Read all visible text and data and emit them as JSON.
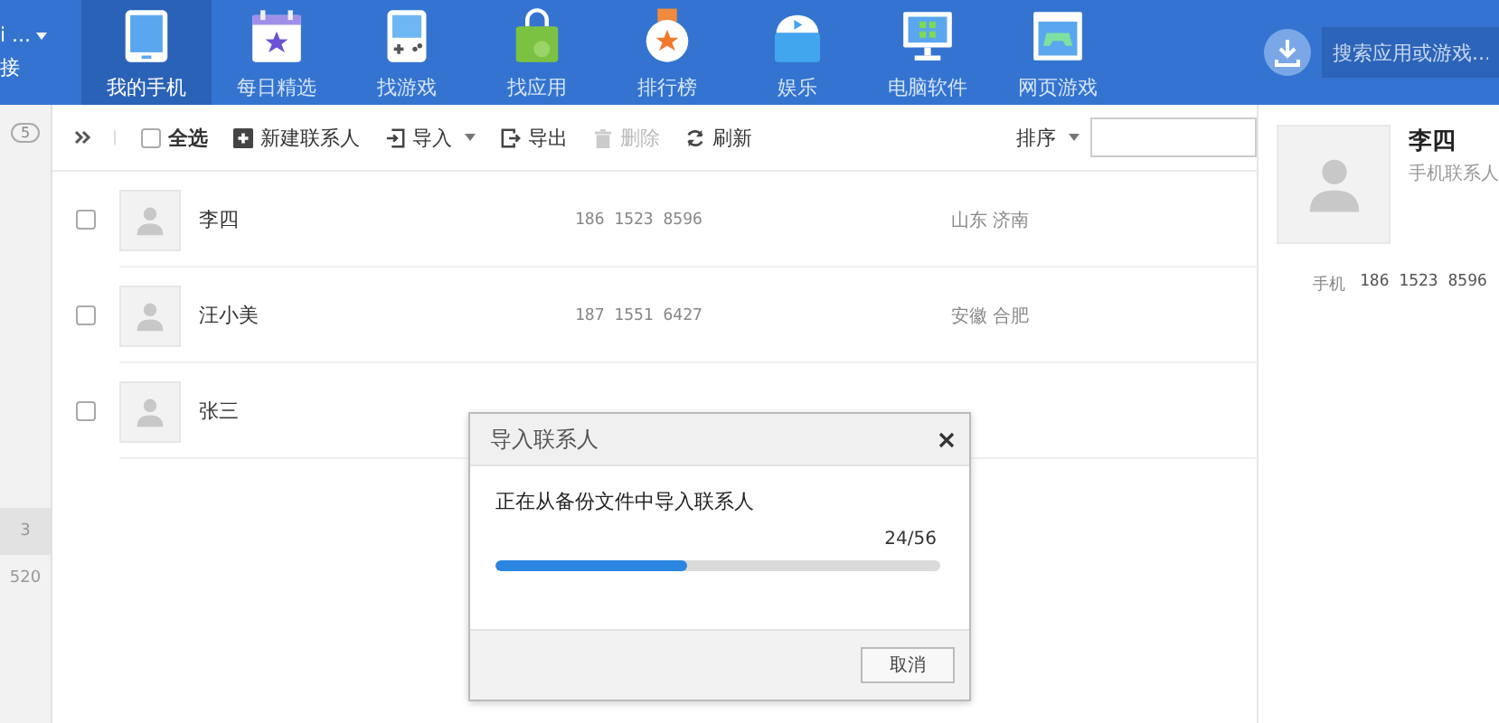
{
  "account": {
    "name": "i ...",
    "subtitle": "接"
  },
  "nav": [
    {
      "label": "我的手机",
      "kind": "phone",
      "selected": true
    },
    {
      "label": "每日精选",
      "kind": "calendar",
      "selected": false
    },
    {
      "label": "找游戏",
      "kind": "handheld",
      "selected": false
    },
    {
      "label": "找应用",
      "kind": "bag",
      "selected": false
    },
    {
      "label": "排行榜",
      "kind": "medal",
      "selected": false
    },
    {
      "label": "娱乐",
      "kind": "box",
      "selected": false
    },
    {
      "label": "电脑软件",
      "kind": "monitor",
      "selected": false
    },
    {
      "label": "网页游戏",
      "kind": "browser",
      "selected": false
    }
  ],
  "search": {
    "placeholder": "搜索应用或游戏..."
  },
  "sidebar": {
    "badge": "5",
    "items": [
      {
        "label": "3",
        "selected": true
      },
      {
        "label": "520",
        "selected": false
      }
    ]
  },
  "toolbar": {
    "buttons": [
      {
        "label": "全选",
        "kind": "checkbox",
        "checked": false,
        "disabled": false
      },
      {
        "label": "新建联系人",
        "kind": "new",
        "disabled": false
      },
      {
        "label": "导入",
        "kind": "import",
        "disabled": false
      },
      {
        "label": "导出",
        "kind": "export",
        "disabled": false
      },
      {
        "label": "删除",
        "kind": "delete",
        "disabled": true
      },
      {
        "label": "刷新",
        "kind": "refresh",
        "disabled": false
      }
    ],
    "sort": {
      "label": "排序"
    }
  },
  "contacts": [
    {
      "name": "李四",
      "phone": "186 1523 8596",
      "location": "山东 济南",
      "checked": false
    },
    {
      "name": "汪小美",
      "phone": "187 1551 6427",
      "location": "安徽 合肥",
      "checked": false
    },
    {
      "name": "张三",
      "checked": false
    }
  ],
  "detail": {
    "name": "李四",
    "type": "手机联系人",
    "phone_label": "手机",
    "phone": "186 1523 8596"
  },
  "dialog": {
    "title": "导入联系人",
    "message": "正在从备份文件中导入联系人",
    "progress_text": "24/56",
    "level": 0.43,
    "buttons": [
      "取消"
    ]
  }
}
